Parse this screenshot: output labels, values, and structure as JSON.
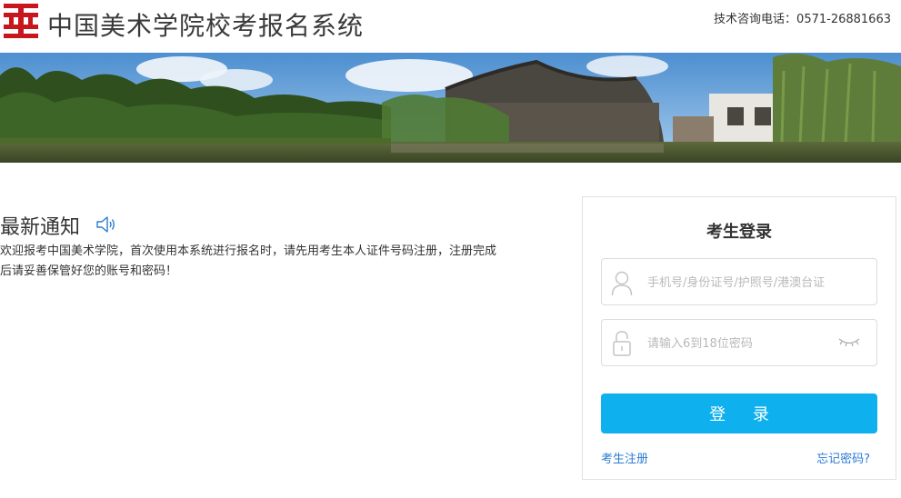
{
  "header": {
    "title": "中国美术学院校考报名系统",
    "hotline": "技术咨询电话：0571-26881663",
    "logo_color": "#c8161d"
  },
  "banner": {
    "image_icon": "campus-lake-photo"
  },
  "notice": {
    "title": "最新通知",
    "text": "欢迎报考中国美术学院，首次使用本系统进行报名时，请先用考生本人证件号码注册，注册完成后请妥善保管好您的账号和密码！"
  },
  "login": {
    "title": "考生登录",
    "username_placeholder": "手机号/身份证号/护照号/港澳台证",
    "username_value": "",
    "password_placeholder": "请输入6到18位密码",
    "password_value": "",
    "submit_label": "登 录",
    "register_link": "考生注册",
    "forgot_link": "忘记密码?",
    "accent_color": "#0fb0ee",
    "link_color": "#2b7bd3"
  }
}
